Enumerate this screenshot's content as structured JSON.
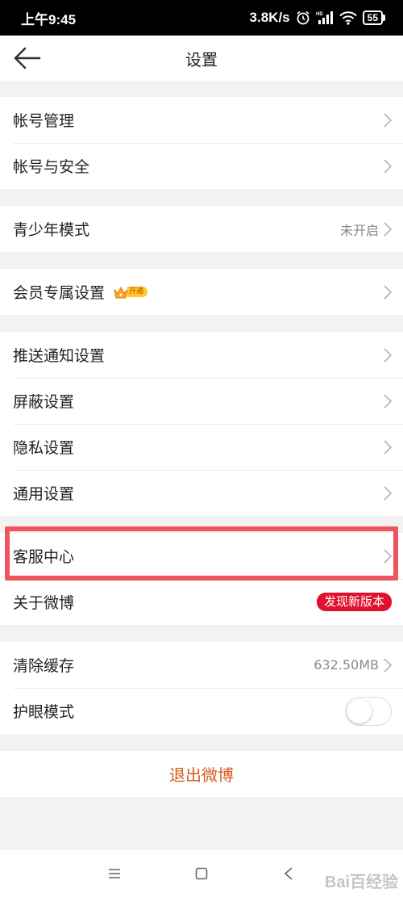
{
  "status_bar": {
    "time": "上午9:45",
    "speed": "3.8K/s",
    "battery": "55"
  },
  "header": {
    "title": "设置"
  },
  "groups": [
    {
      "items": [
        {
          "label": "帐号管理"
        },
        {
          "label": "帐号与安全"
        }
      ]
    },
    {
      "items": [
        {
          "label": "青少年模式",
          "value": "未开启"
        }
      ]
    },
    {
      "items": [
        {
          "label": "会员专属设置",
          "badge": "开通"
        }
      ]
    },
    {
      "items": [
        {
          "label": "推送通知设置"
        },
        {
          "label": "屏蔽设置"
        },
        {
          "label": "隐私设置"
        },
        {
          "label": "通用设置"
        }
      ]
    },
    {
      "items": [
        {
          "label": "客服中心"
        },
        {
          "label": "关于微博",
          "badge": "发现新版本"
        }
      ]
    },
    {
      "items": [
        {
          "label": "清除缓存",
          "value": "632.50MB"
        },
        {
          "label": "护眼模式",
          "toggle": false
        }
      ]
    }
  ],
  "logout": {
    "label": "退出微博"
  },
  "watermark": "Bai百经验",
  "colors": {
    "highlight": "#f0545f",
    "logout_text": "#d35a22",
    "new_version_badge": "#e0102e",
    "vip_badge": "#ffca28"
  },
  "icons": {
    "back": "arrow-left-icon",
    "chevron": "chevron-right-icon",
    "vip": "crown-icon",
    "nav_menu": "menu-icon",
    "nav_home": "square-icon",
    "nav_back": "triangle-back-icon"
  }
}
